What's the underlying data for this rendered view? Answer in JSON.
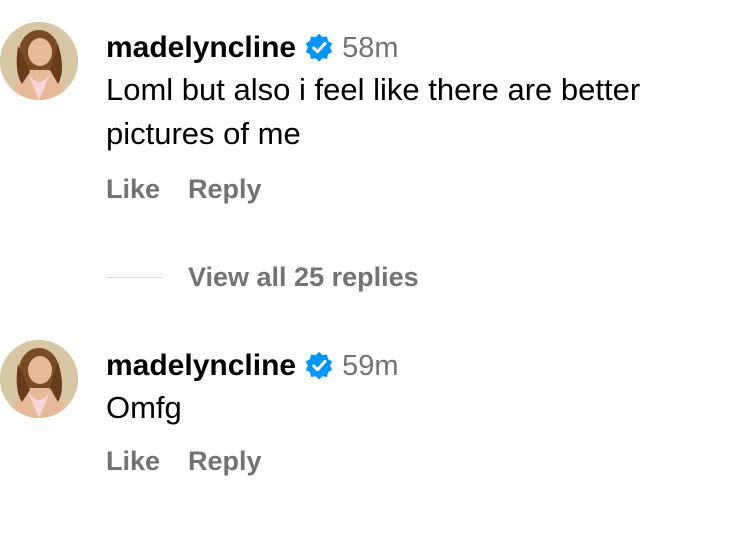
{
  "comments": [
    {
      "username": "madelyncline",
      "timestamp": "58m",
      "text": "Loml but also i feel like there are better pictures of me",
      "like_label": "Like",
      "reply_label": "Reply"
    },
    {
      "username": "madelyncline",
      "timestamp": "59m",
      "text": "Omfg",
      "like_label": "Like",
      "reply_label": "Reply"
    }
  ],
  "view_replies": {
    "label": "View all 25 replies"
  },
  "colors": {
    "verified_badge": "#0095f6",
    "secondary_text": "#737373",
    "primary_text": "#000000"
  },
  "icons": {
    "verified": "verified-badge-icon",
    "avatar": "profile-avatar"
  }
}
